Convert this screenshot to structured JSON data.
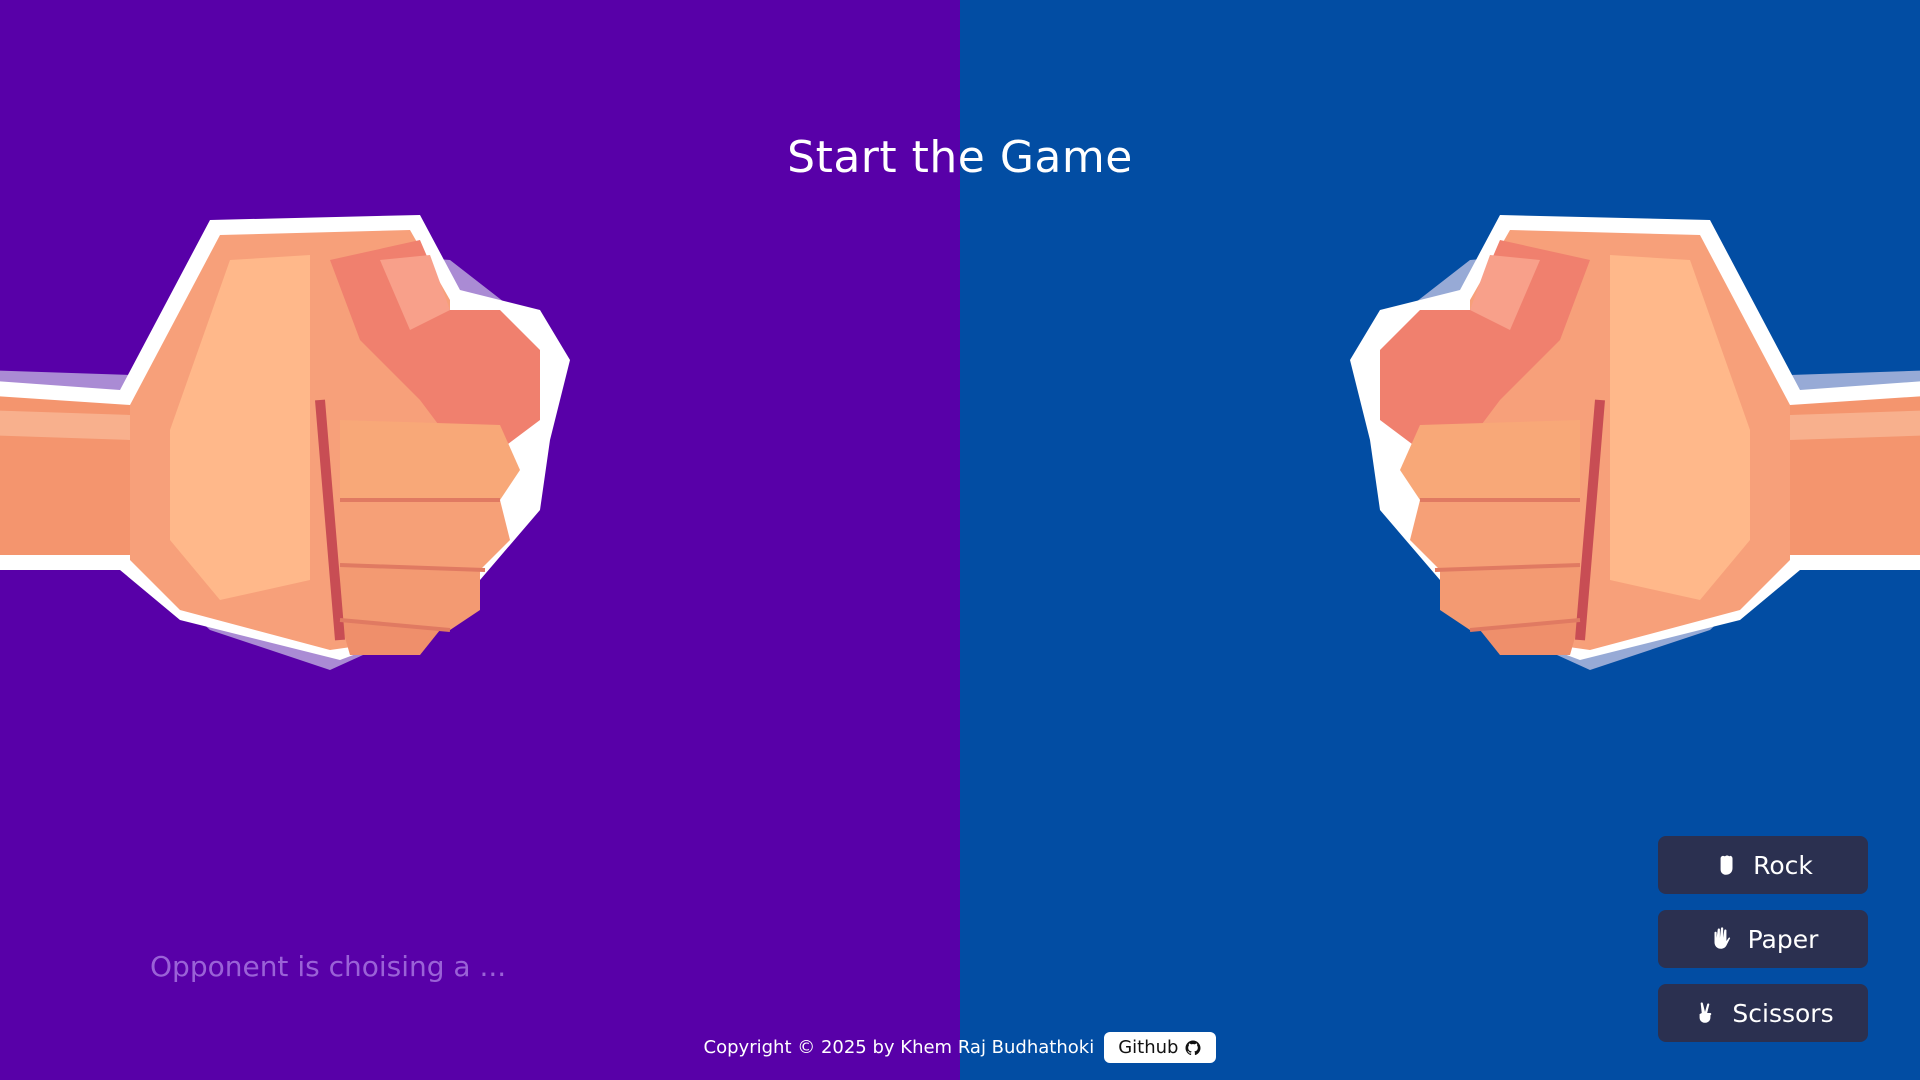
{
  "game": {
    "title": "Start the Game",
    "opponent_status": "Opponent is choising a ..."
  },
  "colors": {
    "player_side": "#5800a8",
    "opponent_side": "#024da3",
    "move_button": "#2b3050"
  },
  "moves": [
    {
      "label": "Rock",
      "icon": "rock-hand-icon"
    },
    {
      "label": "Paper",
      "icon": "open-hand-icon"
    },
    {
      "label": "Scissors",
      "icon": "scissors-hand-icon"
    }
  ],
  "footer": {
    "copyright": "Copyright © 2025 by Khem Raj Budhathoki",
    "github_label": "Github",
    "github_icon": "github-icon"
  }
}
